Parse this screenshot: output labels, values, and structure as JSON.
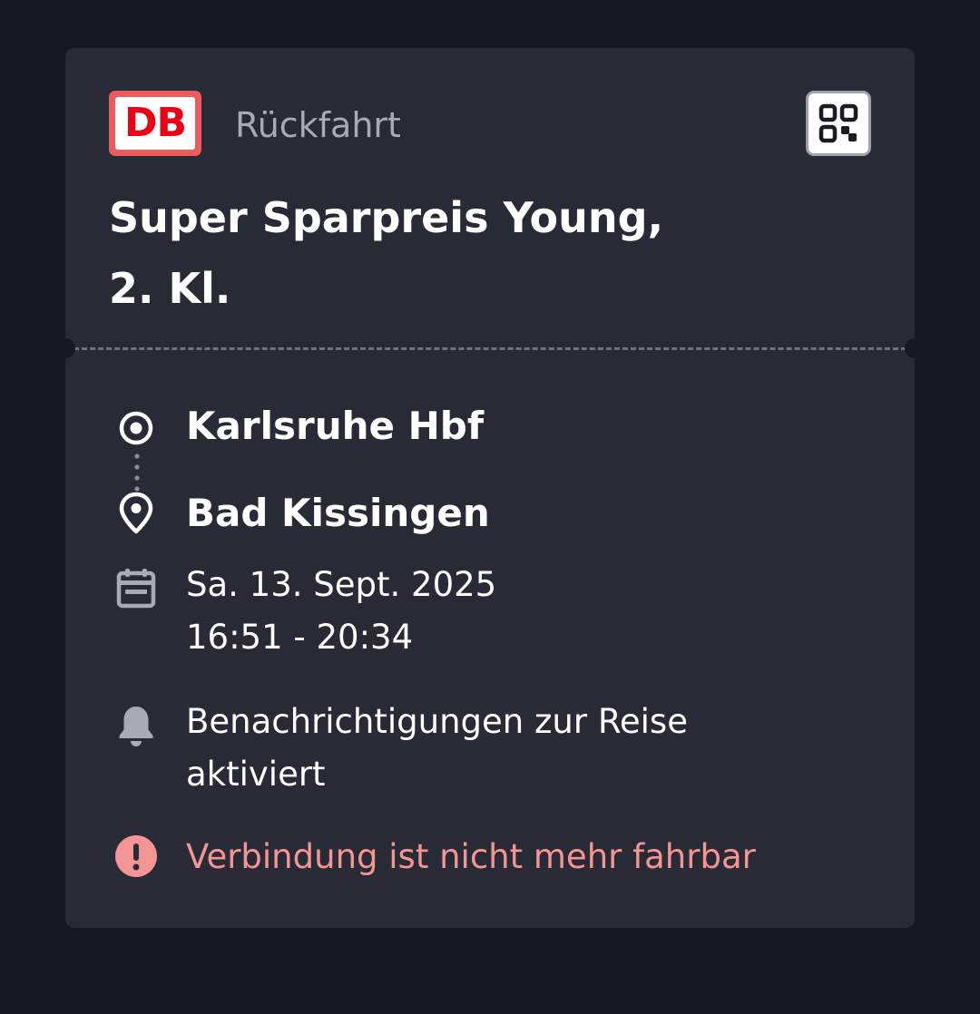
{
  "ticket": {
    "logo_text": "DB",
    "trip_type": "Rückfahrt",
    "title_line1": "Super Sparpreis Young,",
    "title_line2": "2. Kl.",
    "origin": "Karlsruhe Hbf",
    "destination": "Bad Kissingen",
    "date": "Sa. 13. Sept. 2025",
    "time": "16:51 - 20:34",
    "notifications_line1": "Benachrichtigungen zur Reise",
    "notifications_line2": "aktiviert",
    "warning": "Verbindung ist nicht mehr fahrbar"
  },
  "icons": {
    "logo": "db-logo",
    "qr": "qr-code-icon",
    "origin": "origin-circle-icon",
    "destination": "location-pin-icon",
    "date": "calendar-icon",
    "notifications": "bell-icon",
    "warning": "exclamation-circle-icon"
  },
  "colors": {
    "background": "#151820",
    "card": "#282b35",
    "db_red": "#ec0016",
    "warning": "#f39595",
    "muted": "#a8abb3"
  }
}
